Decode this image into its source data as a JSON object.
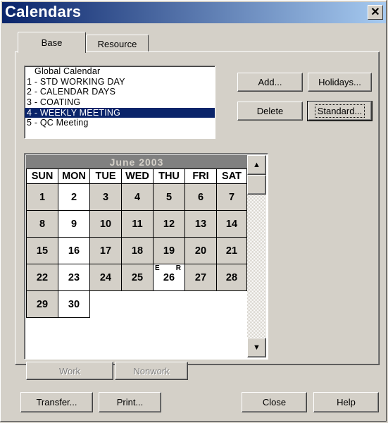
{
  "window": {
    "title": "Calendars"
  },
  "tabs": [
    {
      "label": "Base"
    },
    {
      "label": "Resource"
    }
  ],
  "calendar_list": {
    "items": [
      {
        "text": "   Global Calendar"
      },
      {
        "text": "1 - STD WORKING DAY"
      },
      {
        "text": "2 - CALENDAR DAYS"
      },
      {
        "text": "3 - COATING"
      },
      {
        "text": "4 - WEEKLY MEETING",
        "selected": true
      },
      {
        "text": "5 - QC Meeting"
      }
    ]
  },
  "buttons": {
    "add": "Add...",
    "holidays": "Holidays...",
    "delete": "Delete",
    "standard": "Standard...",
    "work": "Work",
    "nonwork": "Nonwork",
    "transfer": "Transfer...",
    "print": "Print...",
    "close": "Close",
    "help": "Help"
  },
  "calendar": {
    "month_title": "June  2003",
    "days_of_week": [
      "SUN",
      "MON",
      "TUE",
      "WED",
      "THU",
      "FRI",
      "SAT"
    ],
    "weeks": [
      [
        {
          "d": "1"
        },
        {
          "d": "2",
          "white": true
        },
        {
          "d": "3"
        },
        {
          "d": "4"
        },
        {
          "d": "5"
        },
        {
          "d": "6"
        },
        {
          "d": "7"
        }
      ],
      [
        {
          "d": "8"
        },
        {
          "d": "9",
          "white": true
        },
        {
          "d": "10"
        },
        {
          "d": "11"
        },
        {
          "d": "12"
        },
        {
          "d": "13"
        },
        {
          "d": "14"
        }
      ],
      [
        {
          "d": "15"
        },
        {
          "d": "16",
          "white": true
        },
        {
          "d": "17"
        },
        {
          "d": "18"
        },
        {
          "d": "19"
        },
        {
          "d": "20"
        },
        {
          "d": "21"
        }
      ],
      [
        {
          "d": "22"
        },
        {
          "d": "23",
          "white": true
        },
        {
          "d": "24"
        },
        {
          "d": "25"
        },
        {
          "d": "26",
          "white": true,
          "e": "E",
          "r": "R"
        },
        {
          "d": "27"
        },
        {
          "d": "28"
        }
      ],
      [
        {
          "d": "29"
        },
        {
          "d": "30",
          "white": true
        }
      ]
    ]
  },
  "icons": {
    "close": "close-icon",
    "scroll_up": "scroll-up-arrow-icon",
    "scroll_down": "scroll-down-arrow-icon"
  },
  "colors": {
    "titlebar_start": "#0a246a",
    "titlebar_end": "#a6caf0",
    "selection": "#0a246a",
    "face": "#d4d0c8"
  }
}
